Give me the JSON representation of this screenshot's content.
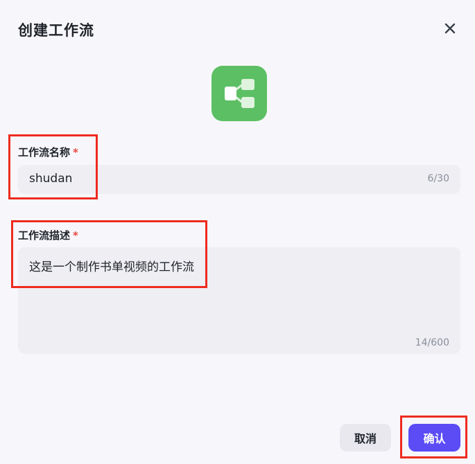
{
  "dialog": {
    "title": "创建工作流",
    "close_icon": "close-icon",
    "logo_icon": "workflow-icon",
    "logo_color": "#5cbf64"
  },
  "name_field": {
    "label": "工作流名称",
    "required_mark": "*",
    "value": "shudan",
    "counter": "6/30"
  },
  "desc_field": {
    "label": "工作流描述",
    "required_mark": "*",
    "value": "这是一个制作书单视频的工作流",
    "counter": "14/600"
  },
  "buttons": {
    "cancel": "取消",
    "confirm": "确认"
  },
  "colors": {
    "accent": "#5b4cf5",
    "highlight": "#ee2b1f",
    "required": "#e5483b"
  }
}
